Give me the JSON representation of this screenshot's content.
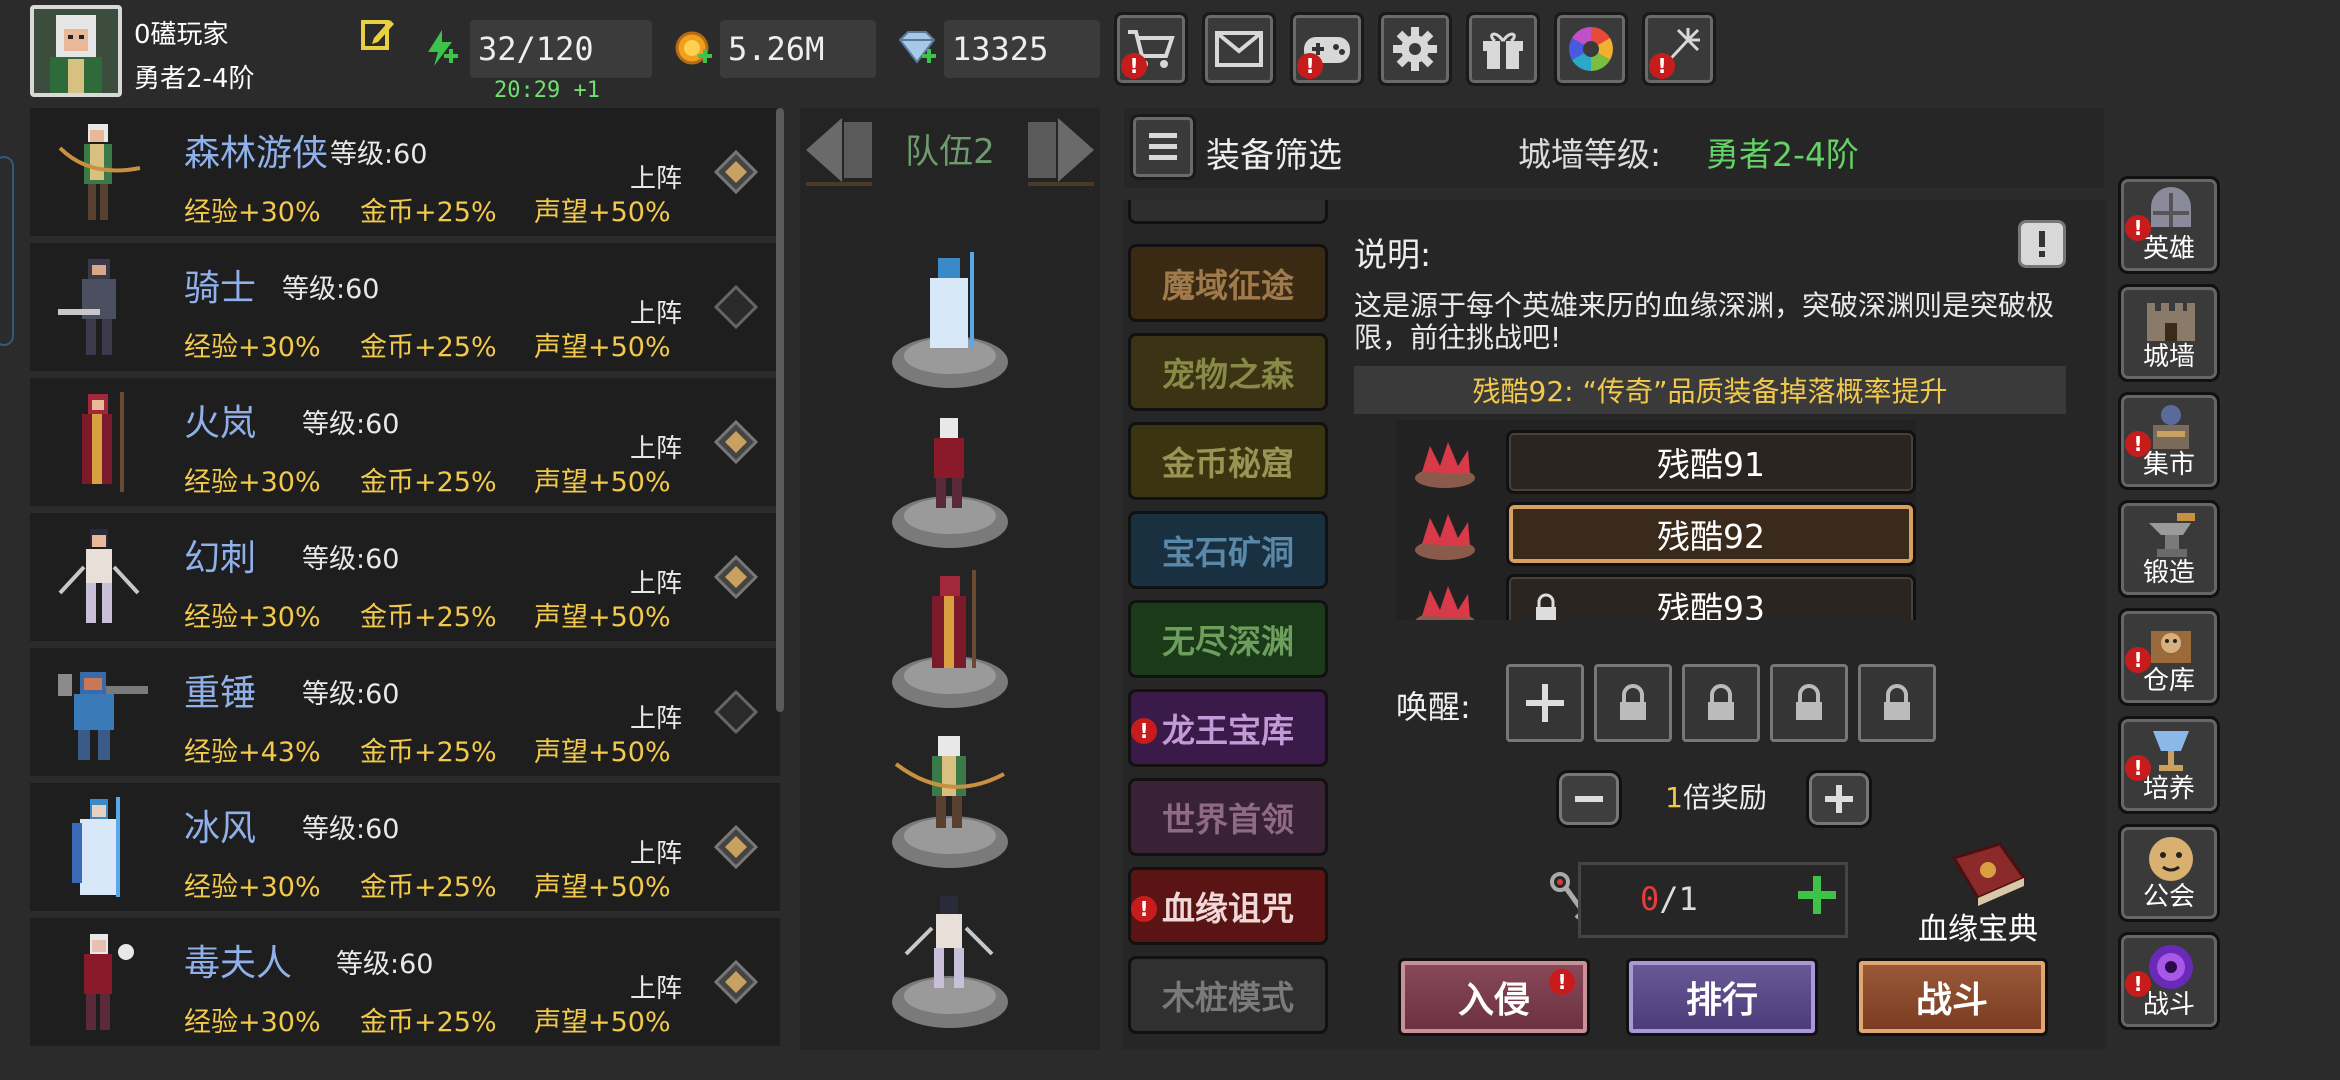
{
  "player": {
    "name": "0礚玩家",
    "rank": "勇者2-4阶"
  },
  "resources": {
    "stamina": "32/120",
    "stamina_timer": "20:29 +1",
    "gold": "5.26M",
    "gems": "13325"
  },
  "top_buttons": [
    {
      "icon": "shopping-cart-icon",
      "alert": true
    },
    {
      "icon": "mail-icon",
      "alert": false
    },
    {
      "icon": "gamepad-icon",
      "alert": true
    },
    {
      "icon": "gear-icon",
      "alert": false
    },
    {
      "icon": "gift-icon",
      "alert": false
    },
    {
      "icon": "color-wheel-icon",
      "alert": false
    },
    {
      "icon": "fireworks-icon",
      "alert": true
    }
  ],
  "heroes": {
    "level_prefix": "等级:",
    "deploy_label": "上阵",
    "items": [
      {
        "name": "森林游侠",
        "level": "60",
        "exp": "经验+30%",
        "gold": "金币+25%",
        "fame": "声望+50%",
        "deployed": true
      },
      {
        "name": "骑士",
        "level": "60",
        "exp": "经验+30%",
        "gold": "金币+25%",
        "fame": "声望+50%",
        "deployed": false
      },
      {
        "name": "火岚",
        "level": "60",
        "exp": "经验+30%",
        "gold": "金币+25%",
        "fame": "声望+50%",
        "deployed": true
      },
      {
        "name": "幻刺",
        "level": "60",
        "exp": "经验+30%",
        "gold": "金币+25%",
        "fame": "声望+50%",
        "deployed": true
      },
      {
        "name": "重锤",
        "level": "60",
        "exp": "经验+43%",
        "gold": "金币+25%",
        "fame": "声望+50%",
        "deployed": false
      },
      {
        "name": "冰风",
        "level": "60",
        "exp": "经验+30%",
        "gold": "金币+25%",
        "fame": "声望+50%",
        "deployed": true
      },
      {
        "name": "毒夫人",
        "level": "60",
        "exp": "经验+30%",
        "gold": "金币+25%",
        "fame": "声望+50%",
        "deployed": true
      }
    ]
  },
  "team": {
    "title": "队伍2"
  },
  "panel": {
    "filter_label": "装备筛选",
    "wall_label": "城墙等级:",
    "wall_value": "勇者2-4阶"
  },
  "modes": [
    {
      "label": "魔域征途",
      "bg": "#3a2a14",
      "fg": "#a07a4a",
      "alert": false
    },
    {
      "label": "宠物之森",
      "bg": "#3a3414",
      "fg": "#8a8a48",
      "alert": false
    },
    {
      "label": "金币秘窟",
      "bg": "#3a3410",
      "fg": "#9a9454",
      "alert": false
    },
    {
      "label": "宝石矿洞",
      "bg": "#183040",
      "fg": "#5a88a8",
      "alert": false
    },
    {
      "label": "无尽深渊",
      "bg": "#1a3a18",
      "fg": "#6e9e5e",
      "alert": false
    },
    {
      "label": "龙王宝库",
      "bg": "#3a1a48",
      "fg": "#c39ad8",
      "alert": true
    },
    {
      "label": "世界首领",
      "bg": "#3a2236",
      "fg": "#8e6a84",
      "alert": false
    },
    {
      "label": "血缘诅咒",
      "bg": "#5a1414",
      "fg": "#f0d8d8",
      "alert": true
    },
    {
      "label": "木桩模式",
      "bg": "#303030",
      "fg": "#7a7a7a",
      "alert": false
    }
  ],
  "description": {
    "title": "说明:",
    "text": "这是源于每个英雄来历的血缘深渊，突破深渊则是突破极限，前往挑战吧!",
    "bonus": "残酷92: “传奇”品质装备掉落概率提升"
  },
  "levels": [
    {
      "label": "残酷91",
      "selected": false,
      "locked": false
    },
    {
      "label": "残酷92",
      "selected": true,
      "locked": false
    },
    {
      "label": "残酷93",
      "selected": false,
      "locked": true
    }
  ],
  "awaken": {
    "label": "唤醒:"
  },
  "reward": {
    "num": "1",
    "suffix": "倍奖励"
  },
  "keys": {
    "current": "0",
    "sep": "/",
    "max": "1"
  },
  "book": {
    "label": "血缘宝典"
  },
  "actions": {
    "invade": "入侵",
    "rank": "排行",
    "battle": "战斗"
  },
  "sidebar": [
    {
      "label": "英雄",
      "icon": "helmet-icon",
      "alert": true
    },
    {
      "label": "城墙",
      "icon": "castle-wall-icon",
      "alert": false
    },
    {
      "label": "集市",
      "icon": "market-icon",
      "alert": true
    },
    {
      "label": "锻造",
      "icon": "anvil-icon",
      "alert": false
    },
    {
      "label": "仓库",
      "icon": "warehouse-icon",
      "alert": true
    },
    {
      "label": "培养",
      "icon": "goblet-icon",
      "alert": true
    },
    {
      "label": "公会",
      "icon": "guild-icon",
      "alert": false
    },
    {
      "label": "战斗",
      "icon": "portal-icon",
      "alert": true
    }
  ],
  "colors": {
    "background": "#2b2b2b",
    "hero_name": "#8fb0e8",
    "stat_gold": "#f2c94c",
    "green_accent": "#64d264",
    "alert_red": "#c81c1c"
  }
}
